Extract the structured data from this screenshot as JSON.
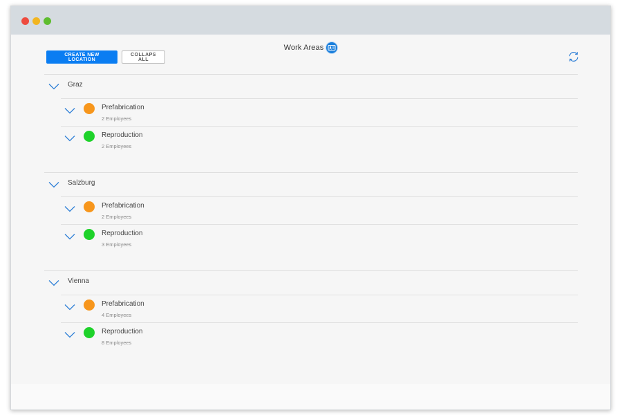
{
  "header": {
    "title": "Work Areas",
    "title_icon": "people-badge-icon"
  },
  "toolbar": {
    "create_label": "CREATE NEW LOCATION",
    "collapse_label": "COLLAPS ALL",
    "refresh_icon": "refresh-icon"
  },
  "colors": {
    "primary": "#0a7df2",
    "orange": "#f7961c",
    "green": "#1ed22a",
    "chevron": "#2e7fd6"
  },
  "locations": [
    {
      "name": "Graz",
      "areas": [
        {
          "name": "Prefabrication",
          "count": "2 Employees",
          "color": "#f7961c"
        },
        {
          "name": "Reproduction",
          "count": "2 Employees",
          "color": "#1ed22a"
        }
      ]
    },
    {
      "name": "Salzburg",
      "areas": [
        {
          "name": "Prefabrication",
          "count": "2 Employees",
          "color": "#f7961c"
        },
        {
          "name": "Reproduction",
          "count": "3 Employees",
          "color": "#1ed22a"
        }
      ]
    },
    {
      "name": "Vienna",
      "areas": [
        {
          "name": "Prefabrication",
          "count": "4 Employees",
          "color": "#f7961c"
        },
        {
          "name": "Reproduction",
          "count": "8 Employees",
          "color": "#1ed22a"
        }
      ]
    }
  ]
}
